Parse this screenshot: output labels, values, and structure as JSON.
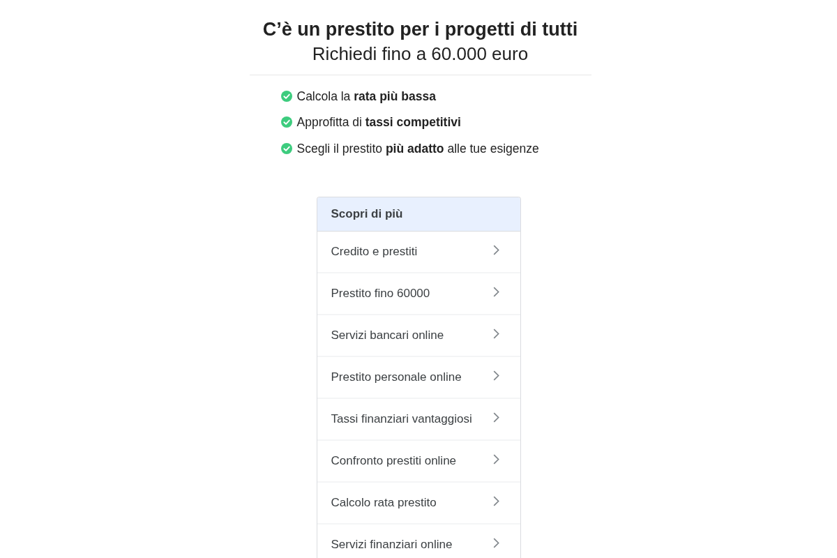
{
  "header": {
    "title": "C’è un prestito per i progetti di tutti",
    "subtitle": "Richiedi fino a 60.000 euro"
  },
  "benefits": [
    "Calcola la **rata più bassa**",
    "Approfitta di **tassi competitivi**",
    "Scegli il prestito **più adatto** alle tue esigenze"
  ],
  "panel": {
    "title": "Scopri di più",
    "items": [
      "Credito e prestiti",
      "Prestito fino 60000",
      "Servizi bancari online",
      "Prestito personale online",
      "Tassi finanziari vantaggiosi",
      "Confronto prestiti online",
      "Calcolo rata prestito",
      "Servizi finanziari online"
    ]
  }
}
